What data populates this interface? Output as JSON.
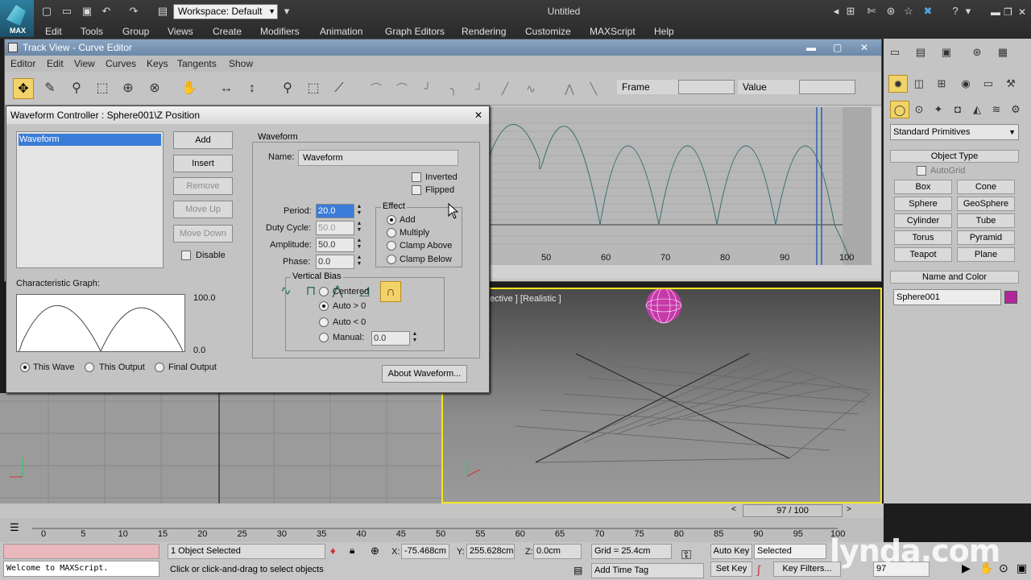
{
  "app": {
    "title": "Untitled",
    "logo_text": "MAX",
    "workspace_label": "Workspace: Default"
  },
  "main_menu": [
    "Edit",
    "Tools",
    "Group",
    "Views",
    "Create",
    "Modifiers",
    "Animation",
    "Graph Editors",
    "Rendering",
    "Customize",
    "MAXScript",
    "Help"
  ],
  "track_view": {
    "title": "Track View - Curve Editor",
    "menu": [
      "Editor",
      "Edit",
      "View",
      "Curves",
      "Keys",
      "Tangents",
      "Show"
    ],
    "frame_label": "Frame",
    "value_label": "Value",
    "ruler_ticks": [
      "50",
      "60",
      "70",
      "80",
      "90",
      "100"
    ]
  },
  "waveform_dialog": {
    "title": "Waveform Controller : Sphere001\\Z Position",
    "list_items": [
      "Waveform"
    ],
    "buttons": {
      "add": "Add",
      "insert": "Insert",
      "remove": "Remove",
      "move_up": "Move Up",
      "move_down": "Move Down",
      "about": "About Waveform..."
    },
    "disable_label": "Disable",
    "char_graph_label": "Characteristic Graph:",
    "graph_max": "100.0",
    "graph_min": "0.0",
    "output_modes": [
      "This Wave",
      "This Output",
      "Final Output"
    ],
    "waveform_group": "Waveform",
    "name_label": "Name:",
    "name_value": "Waveform",
    "inverted_label": "Inverted",
    "flipped_label": "Flipped",
    "period_label": "Period:",
    "period_value": "20.0",
    "duty_label": "Duty Cycle:",
    "duty_value": "50.0",
    "amplitude_label": "Amplitude:",
    "amplitude_value": "50.0",
    "phase_label": "Phase:",
    "phase_value": "0.0",
    "effect_group": "Effect",
    "effects": [
      "Add",
      "Multiply",
      "Clamp Above",
      "Clamp Below"
    ],
    "vbias_group": "Vertical Bias",
    "vbias": [
      "Centered",
      "Auto > 0",
      "Auto < 0",
      "Manual:"
    ],
    "manual_value": "0.0"
  },
  "viewport": {
    "persp_label": "ective ] [Realistic ]"
  },
  "command_panel": {
    "category": "Standard Primitives",
    "object_type": "Object Type",
    "autogrid": "AutoGrid",
    "primitives": [
      "Box",
      "Cone",
      "Sphere",
      "GeoSphere",
      "Cylinder",
      "Tube",
      "Torus",
      "Pyramid",
      "Teapot",
      "Plane"
    ],
    "name_and_color": "Name and Color",
    "object_name": "Sphere001",
    "object_color": "#b4249c"
  },
  "timeline": {
    "slider_text": "97 / 100",
    "ticks": [
      "0",
      "5",
      "10",
      "15",
      "20",
      "25",
      "30",
      "35",
      "40",
      "45",
      "50",
      "55",
      "60",
      "65",
      "70",
      "75",
      "80",
      "85",
      "90",
      "95",
      "100"
    ]
  },
  "status": {
    "selection": "1 Object Selected",
    "prompt": "Click or click-and-drag to select objects",
    "welcome": "Welcome to MAXScript.",
    "x_label": "X:",
    "x_value": "-75.468cm",
    "y_label": "Y:",
    "y_value": "255.628cm",
    "z_label": "Z:",
    "z_value": "0.0cm",
    "grid": "Grid = 25.4cm",
    "add_time_tag": "Add Time Tag",
    "auto_key": "Auto Key",
    "set_key": "Set Key",
    "key_mode": "Selected",
    "key_filters": "Key Filters...",
    "current_frame": "97"
  },
  "watermark": "lynda.com"
}
